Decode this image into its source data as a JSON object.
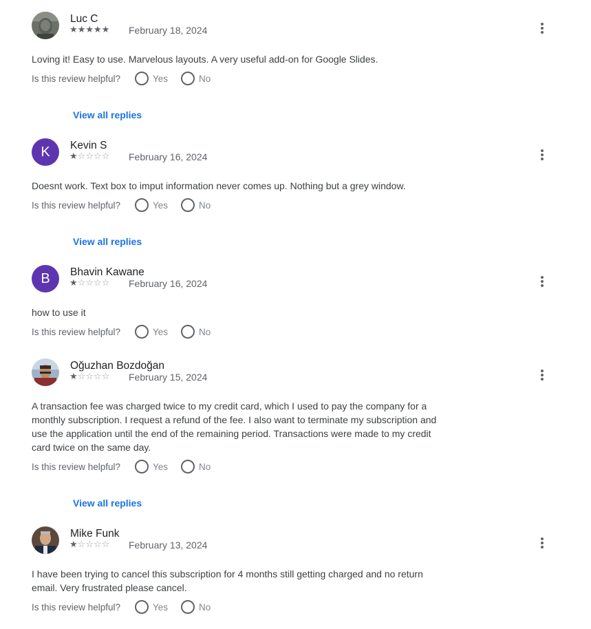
{
  "helpful_prompt": "Is this review helpful?",
  "yes_label": "Yes",
  "no_label": "No",
  "view_replies_label": "View all replies",
  "colors": {
    "avatar_letter_bg": "#5e35b1",
    "link": "#1a73e8"
  },
  "reviews": [
    {
      "author": "Luc C",
      "rating": 5,
      "date": "February 18, 2024",
      "avatar_type": "photo",
      "text": "Loving it! Easy to use. Marvelous layouts. A very useful add-on for Google Slides.",
      "has_replies": true
    },
    {
      "author": "Kevin S",
      "rating": 1,
      "date": "February 16, 2024",
      "avatar_type": "letter",
      "avatar_letter": "K",
      "text": "Doesnt work.  Text box to imput information never comes up.  Nothing but a grey window.",
      "has_replies": true
    },
    {
      "author": "Bhavin Kawane",
      "rating": 1,
      "date": "February 16, 2024",
      "avatar_type": "letter",
      "avatar_letter": "B",
      "text": "how to use it",
      "has_replies": false
    },
    {
      "author": "Oğuzhan Bozdoğan",
      "rating": 1,
      "date": "February 15, 2024",
      "avatar_type": "photo",
      "text": "A transaction fee was charged twice to my credit card, which I used to pay the company for a monthly subscription. I request a refund of the fee. I also want to terminate my subscription and use the application until the end of the remaining period. Transactions were made to my credit card twice on the same day.",
      "has_replies": true
    },
    {
      "author": "Mike Funk",
      "rating": 1,
      "date": "February 13, 2024",
      "avatar_type": "photo",
      "text": "I have been trying to cancel this subscription for 4 months still getting charged and no return email. Very frustrated please cancel.",
      "has_replies": false
    }
  ]
}
